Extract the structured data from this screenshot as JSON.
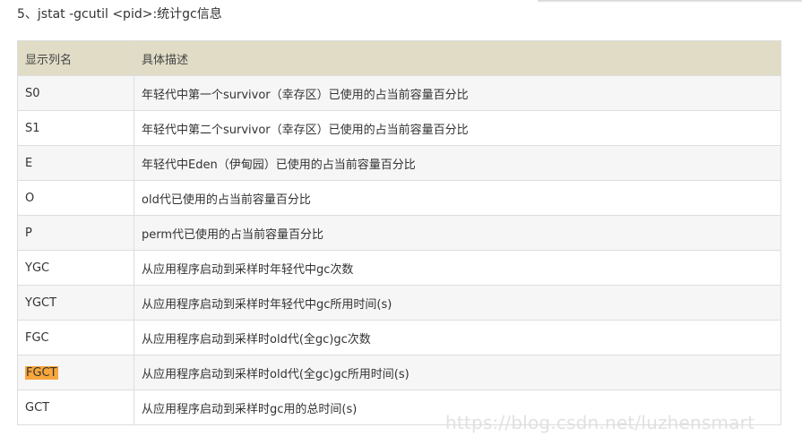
{
  "heading": "5、jstat -gcutil <pid>:统计gc信息",
  "table": {
    "headers": [
      "显示列名",
      "具体描述"
    ],
    "rows": [
      {
        "name": "S0",
        "desc": "年轻代中第一个survivor（幸存区）已使用的占当前容量百分比"
      },
      {
        "name": "S1",
        "desc": "年轻代中第二个survivor（幸存区）已使用的占当前容量百分比"
      },
      {
        "name": "E",
        "desc": "年轻代中Eden（伊甸园）已使用的占当前容量百分比"
      },
      {
        "name": "O",
        "desc": "old代已使用的占当前容量百分比"
      },
      {
        "name": "P",
        "desc": "perm代已使用的占当前容量百分比"
      },
      {
        "name": "YGC",
        "desc": "从应用程序启动到采样时年轻代中gc次数"
      },
      {
        "name": "YGCT",
        "desc": "从应用程序启动到采样时年轻代中gc所用时间(s)"
      },
      {
        "name": "FGC",
        "desc": "从应用程序启动到采样时old代(全gc)gc次数"
      },
      {
        "name": "FGCT",
        "desc": "从应用程序启动到采样时old代(全gc)gc所用时间(s)"
      },
      {
        "name": "GCT",
        "desc": "从应用程序启动到采样时gc用的总时间(s)"
      }
    ]
  },
  "watermark": "https://blog.csdn.net/luzhensmart",
  "colors": {
    "header_bg": "#e0dcc6",
    "highlight": "#f7a63c"
  }
}
